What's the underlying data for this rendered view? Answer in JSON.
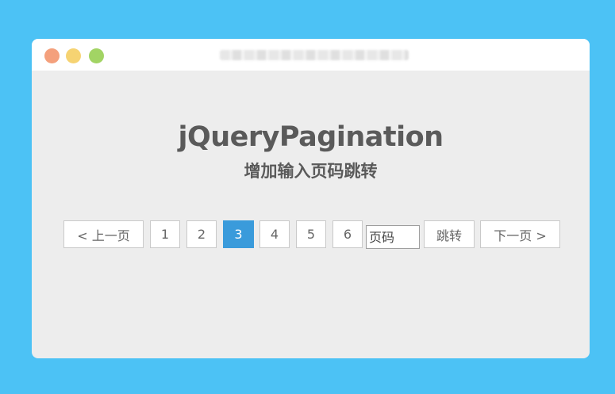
{
  "window": {
    "controls": [
      {
        "name": "close",
        "color": "#f4a07c"
      },
      {
        "name": "minimize",
        "color": "#f6d372"
      },
      {
        "name": "maximize",
        "color": "#a2d464"
      }
    ]
  },
  "header": {
    "title": "jQueryPagination",
    "subtitle": "增加输入页码跳转"
  },
  "pagination": {
    "prev_label": "< 上一页",
    "pages": [
      "1",
      "2",
      "3",
      "4",
      "5",
      "6"
    ],
    "active_page": "3",
    "input_placeholder": "页码",
    "input_value": "",
    "jump_label": "跳转",
    "next_label": "下一页 >"
  },
  "colors": {
    "background": "#4cc2f5",
    "window": "#ededed",
    "active": "#3a9bdb",
    "text": "#5a5a5a"
  }
}
